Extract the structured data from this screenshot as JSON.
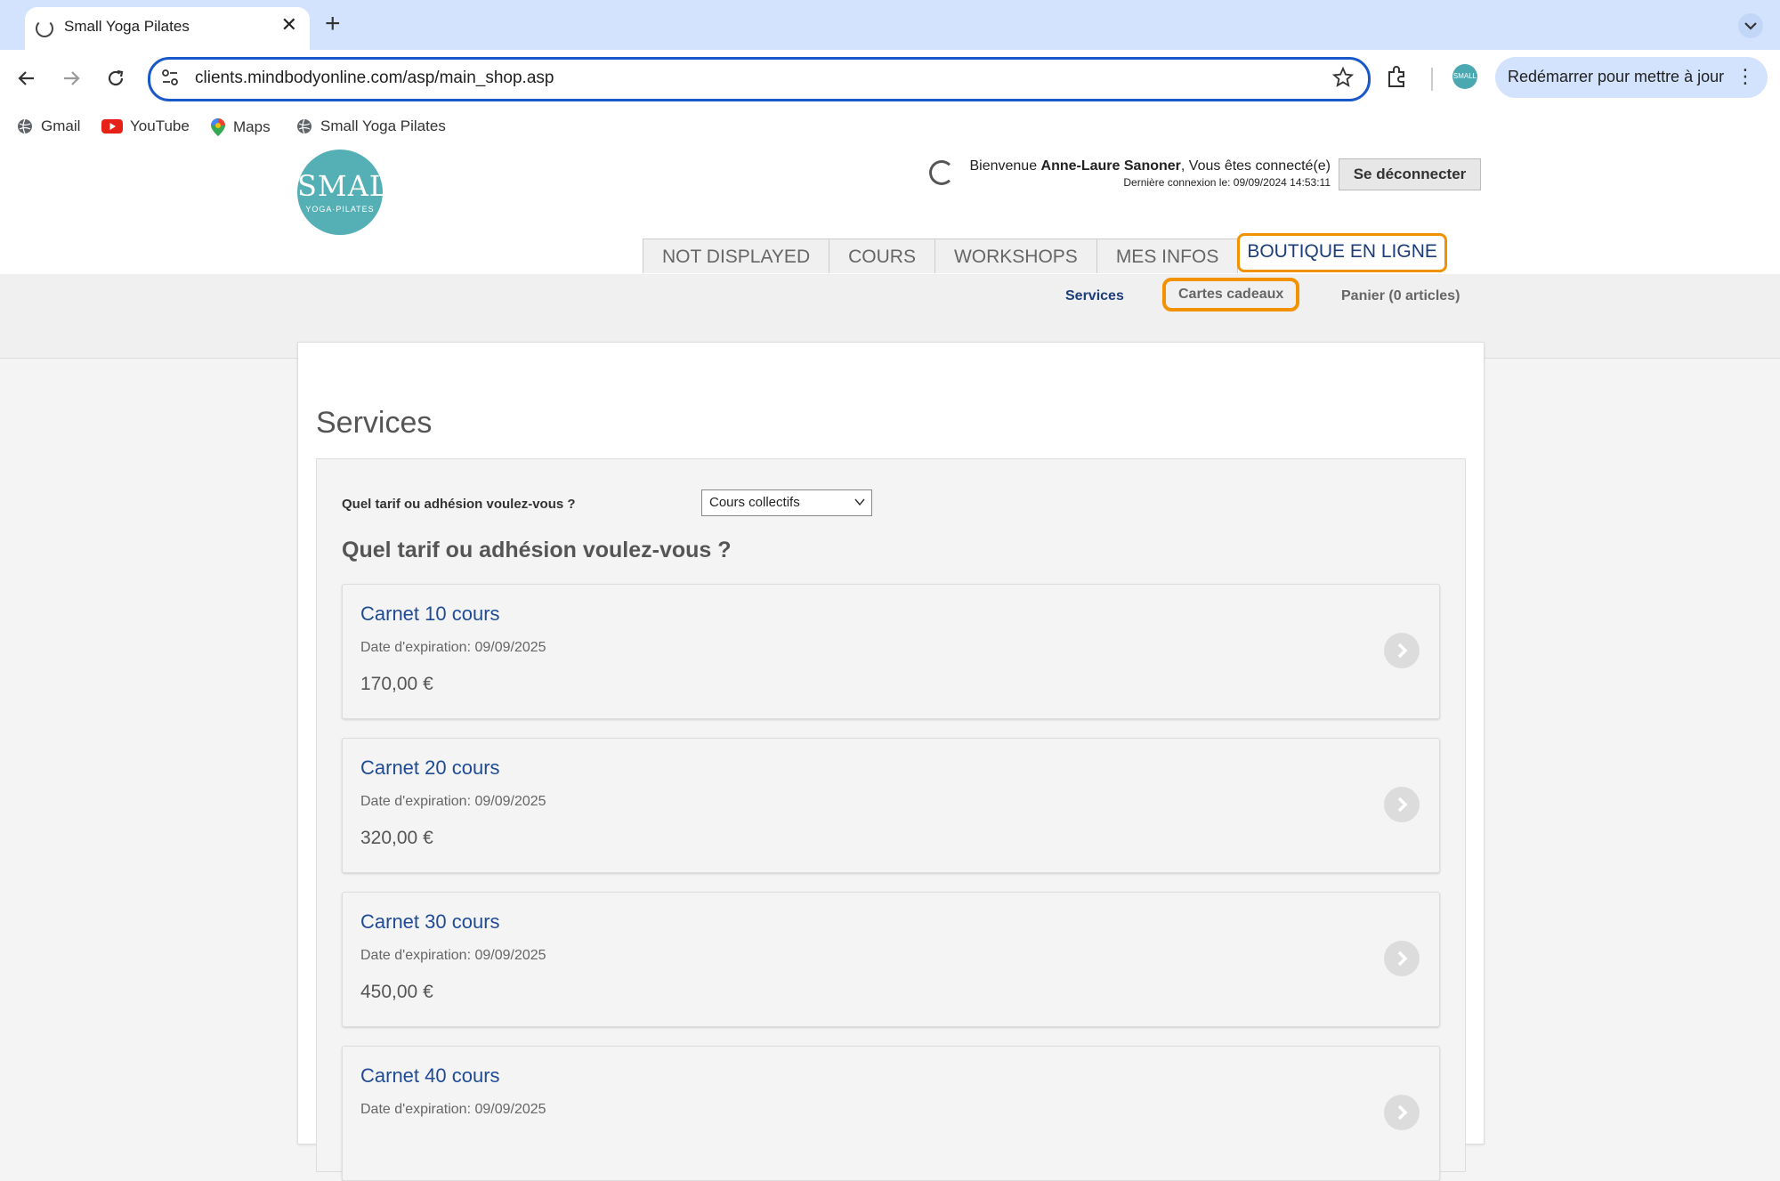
{
  "browser": {
    "tab_title": "Small Yoga Pilates",
    "url": "clients.mindbodyonline.com/asp/main_shop.asp",
    "update_button": "Redémarrer pour mettre à jour",
    "profile_label": "SMALL",
    "bookmarks": [
      {
        "label": "Gmail",
        "icon": "globe-icon"
      },
      {
        "label": "YouTube",
        "icon": "youtube-icon"
      },
      {
        "label": "Maps",
        "icon": "maps-pin-icon"
      },
      {
        "label": "Small Yoga Pilates",
        "icon": "globe-icon"
      }
    ]
  },
  "header": {
    "logo_main": "SMALL",
    "logo_sub": "YOGA·PILATES",
    "welcome_prefix": "Bienvenue ",
    "user_name": "Anne-Laure Sanoner",
    "welcome_suffix": ", Vous êtes connecté(e)",
    "last_login": "Dernière connexion le: 09/09/2024 14:53:11",
    "logout_label": "Se déconnecter"
  },
  "main_tabs": [
    "NOT DISPLAYED",
    "COURS",
    "WORKSHOPS",
    "MES INFOS",
    "BOUTIQUE EN LIGNE"
  ],
  "subnav": {
    "services": "Services",
    "gift_cards": "Cartes cadeaux",
    "cart": "Panier (0 articles)"
  },
  "content": {
    "title": "Services",
    "filter_label": "Quel tarif ou adhésion voulez-vous ?",
    "filter_value": "Cours collectifs",
    "section_heading": "Quel tarif ou adhésion voulez-vous ?"
  },
  "items": [
    {
      "name": "Carnet 10 cours",
      "expiration": "Date d'expiration: 09/09/2025",
      "price": "170,00 €"
    },
    {
      "name": "Carnet 20 cours",
      "expiration": "Date d'expiration: 09/09/2025",
      "price": "320,00 €"
    },
    {
      "name": "Carnet 30 cours",
      "expiration": "Date d'expiration: 09/09/2025",
      "price": "450,00 €"
    },
    {
      "name": "Carnet 40 cours",
      "expiration": "Date d'expiration: 09/09/2025",
      "price": ""
    }
  ],
  "colors": {
    "accent_highlight": "#f39200",
    "link_blue": "#1f4b96",
    "chrome_tab_bg": "#d3e3fd",
    "logo_teal": "#55b0b5"
  }
}
